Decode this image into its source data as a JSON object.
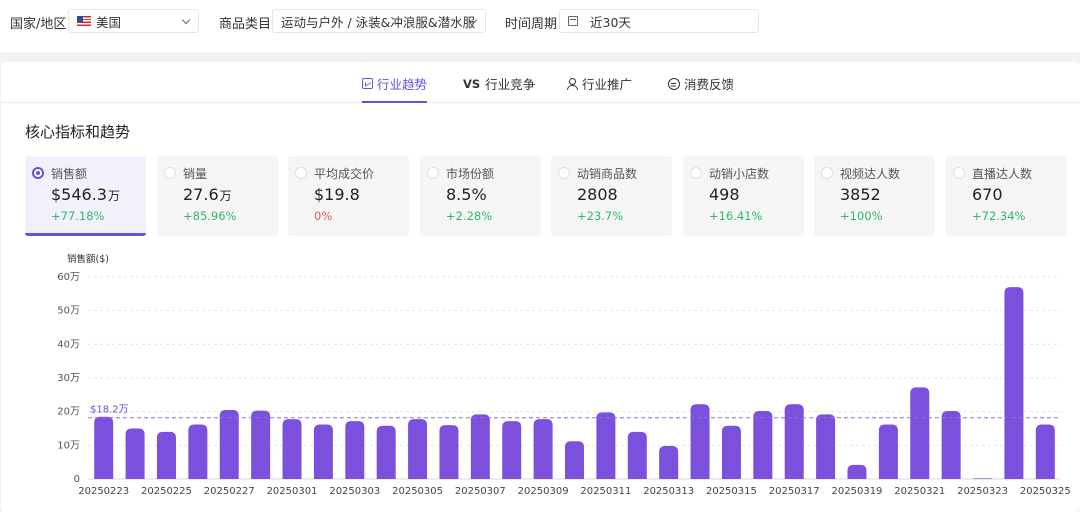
{
  "filters": {
    "region_label": "国家/地区",
    "region_value": "美国",
    "category_label": "商品类目",
    "category_value": "运动与户外 / 泳装&冲浪服&潜水服",
    "period_label": "时间周期",
    "period_value": "近30天"
  },
  "tabs": [
    {
      "label": "行业趋势",
      "active": true
    },
    {
      "label": "行业竞争",
      "active": false
    },
    {
      "label": "行业推广",
      "active": false
    },
    {
      "label": "消费反馈",
      "active": false
    }
  ],
  "vs_mark": "VS",
  "section_title": "核心指标和趋势",
  "metrics": [
    {
      "label": "销售额",
      "value": "$546.3",
      "unit": "万",
      "change": "+77.18%",
      "active": true
    },
    {
      "label": "销量",
      "value": "27.6",
      "unit": "万",
      "change": "+85.96%",
      "active": false
    },
    {
      "label": "平均成交价",
      "value": "$19.8",
      "unit": "",
      "change": "0%",
      "active": false
    },
    {
      "label": "市场份额",
      "value": "8.5%",
      "unit": "",
      "change": "+2.28%",
      "active": false
    },
    {
      "label": "动销商品数",
      "value": "2808",
      "unit": "",
      "change": "+23.7%",
      "active": false
    },
    {
      "label": "动销小店数",
      "value": "498",
      "unit": "",
      "change": "+16.41%",
      "active": false
    },
    {
      "label": "视频达人数",
      "value": "3852",
      "unit": "",
      "change": "+100%",
      "active": false
    },
    {
      "label": "直播达人数",
      "value": "670",
      "unit": "",
      "change": "+72.34%",
      "active": false
    }
  ],
  "colors": {
    "accent": "#6b4fd8",
    "bar": "#7a50dc",
    "positive": "#2fb86b",
    "neutral_change": "#e85a4f"
  },
  "chart_data": {
    "type": "bar",
    "ylabel": "销售额($)",
    "ylim": [
      0,
      600000
    ],
    "y_ticks": [
      {
        "value": 0,
        "label": "0"
      },
      {
        "value": 100000,
        "label": "10万"
      },
      {
        "value": 200000,
        "label": "20万"
      },
      {
        "value": 300000,
        "label": "30万"
      },
      {
        "value": 400000,
        "label": "40万"
      },
      {
        "value": 500000,
        "label": "50万"
      },
      {
        "value": 600000,
        "label": "60万"
      }
    ],
    "grid": true,
    "average": {
      "value": 182000,
      "label": "$18.2万"
    },
    "categories": [
      "20250223",
      "20250224",
      "20250225",
      "20250226",
      "20250227",
      "20250228",
      "20250301",
      "20250302",
      "20250303",
      "20250304",
      "20250305",
      "20250306",
      "20250307",
      "20250308",
      "20250309",
      "20250310",
      "20250311",
      "20250312",
      "20250313",
      "20250314",
      "20250315",
      "20250316",
      "20250317",
      "20250318",
      "20250319",
      "20250320",
      "20250321",
      "20250322",
      "20250323",
      "20250324",
      "20250325"
    ],
    "x_tick_labels": [
      "20250223",
      "20250225",
      "20250227",
      "20250301",
      "20250303",
      "20250305",
      "20250307",
      "20250309",
      "20250311",
      "20250313",
      "20250315",
      "20250317",
      "20250319",
      "20250321",
      "20250323",
      "20250325"
    ],
    "values": [
      185000,
      150000,
      140000,
      162000,
      205000,
      203000,
      178000,
      162000,
      172000,
      158000,
      178000,
      160000,
      192000,
      172000,
      178000,
      112000,
      198000,
      140000,
      98000,
      222000,
      158000,
      202000,
      222000,
      192000,
      42000,
      162000,
      272000,
      202000,
      2000,
      570000,
      162000
    ]
  }
}
